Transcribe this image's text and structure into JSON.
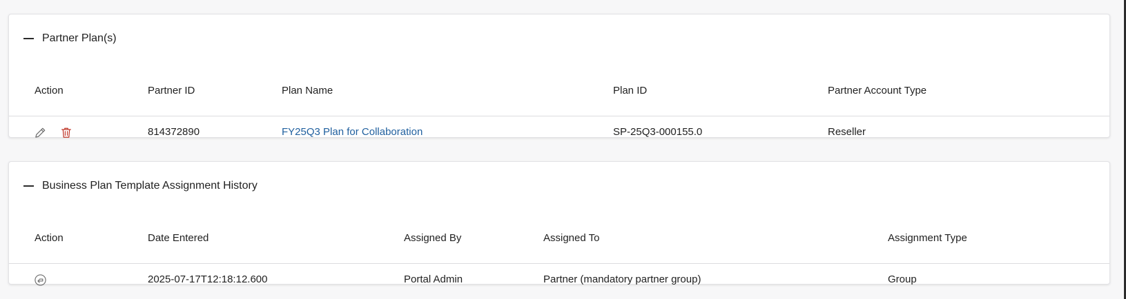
{
  "partner_plans": {
    "title": "Partner Plan(s)",
    "columns": [
      "Action",
      "Partner ID",
      "Plan Name",
      "Plan ID",
      "Partner Account Type"
    ],
    "rows": [
      {
        "partner_id": "814372890",
        "plan_name": "FY25Q3 Plan for Collaboration",
        "plan_id": "SP-25Q3-000155.0",
        "account_type": "Reseller",
        "actions": [
          "pencil-icon",
          "trash-icon"
        ]
      }
    ]
  },
  "assignment_history": {
    "title": "Business Plan Template Assignment History",
    "columns": [
      "Action",
      "Date Entered",
      "Assigned By",
      "Assigned To",
      "Assignment Type"
    ],
    "rows": [
      {
        "date_entered": "2025-07-17T12:18:12.600",
        "assigned_by": "Portal Admin",
        "assigned_to": "Partner (mandatory partner group)",
        "assignment_type": "Group",
        "actions": [
          "revert-icon"
        ]
      }
    ]
  },
  "colors": {
    "link": "#1f5f9e",
    "delete": "#c0392b",
    "text": "#1f1f1f"
  }
}
